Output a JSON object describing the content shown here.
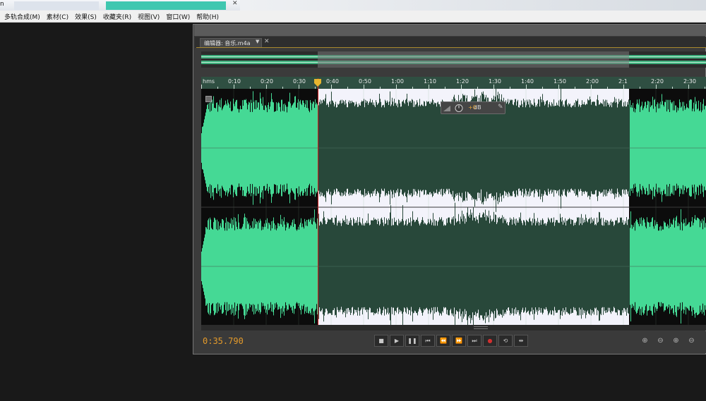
{
  "app": {
    "title_fragment": "n"
  },
  "menu": [
    "多轨合成(M)",
    "素材(C)",
    "效果(S)",
    "收藏夹(R)",
    "视图(V)",
    "窗口(W)",
    "帮助(H)"
  ],
  "editor": {
    "tab_label": "编辑器: 音乐.m4a",
    "tab_menu_icon": "dropdown-triangle-icon",
    "tab_close": "✕"
  },
  "ruler": {
    "unit": "hms",
    "labels": [
      "0:10",
      "0:20",
      "0:30",
      "0:40",
      "0:50",
      "1:00",
      "1:10",
      "1:20",
      "1:30",
      "1:40",
      "1:50",
      "2:00",
      "2:1",
      "2:20",
      "2:30"
    ]
  },
  "hud": {
    "value": "+0",
    "unit": "dB"
  },
  "transport": {
    "current_time": "0:35.790",
    "buttons": [
      "stop-icon",
      "play-icon",
      "pause-icon",
      "go-to-start-icon",
      "rewind-icon",
      "fast-forward-icon",
      "go-to-end-icon",
      "record-icon",
      "loop-icon",
      "skip-selection-icon"
    ]
  },
  "colors": {
    "waveform": "#45d995",
    "selection_bg": "#f3f3fb",
    "selected_waveform": "#28483a",
    "time_text": "#e39a2b"
  }
}
